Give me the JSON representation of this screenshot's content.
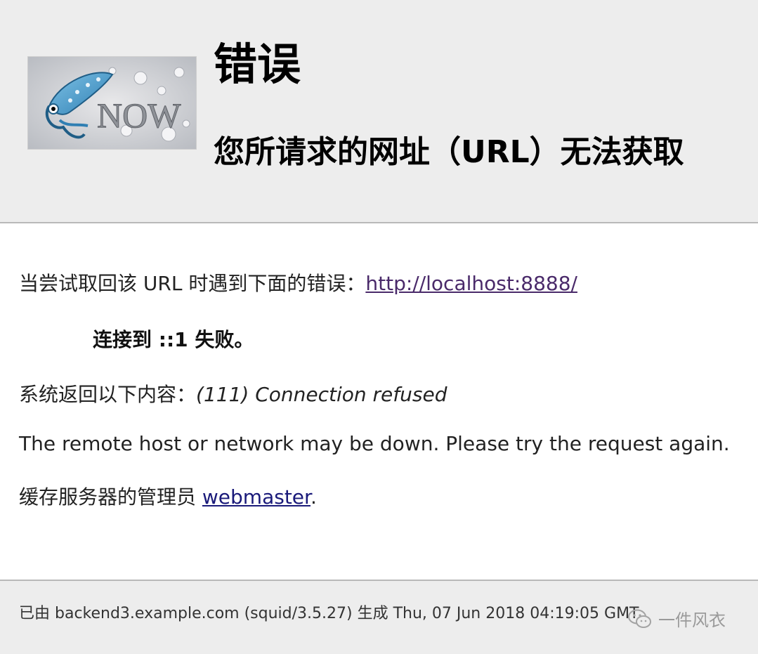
{
  "header": {
    "logo_text": "NOW",
    "title": "错误",
    "subtitle": "您所请求的网址（URL）无法获取"
  },
  "main": {
    "line1_prefix": "当尝试取回该 URL 时遇到下面的错误：",
    "url_link": "http://localhost:8888/",
    "error_detail": "连接到 ::1 失败。",
    "system_prefix": "系统返回以下内容：",
    "system_message": "(111) Connection refused",
    "remote_note": "The remote host or network may be down. Please try the request again.",
    "admin_prefix": "缓存服务器的管理员 ",
    "webmaster_link": "webmaster",
    "admin_suffix": "."
  },
  "footer": {
    "generated_text": "已由 backend3.example.com (squid/3.5.27) 生成 Thu, 07 Jun 2018 04:19:05 GMT",
    "watermark_text": "一件风衣",
    "watermark_icon": "wechat-icon"
  },
  "colors": {
    "header_bg": "#ededed",
    "visited_link": "#4a2a6a",
    "link": "#1a1a7a"
  }
}
